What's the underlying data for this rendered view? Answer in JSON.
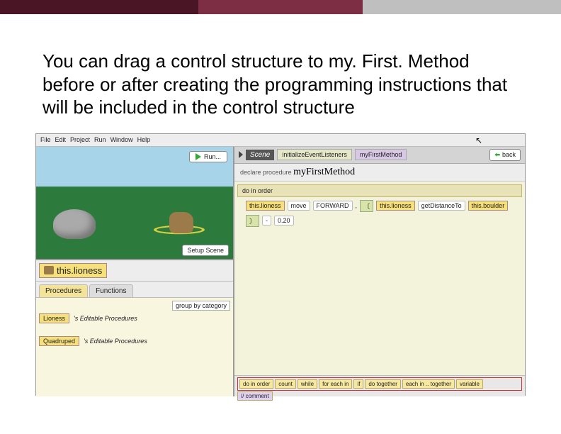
{
  "heading": "You can drag a control structure to my. First. Method before or after creating the programming instructions that will be included in the control structure",
  "menubar": {
    "items": [
      "File",
      "Edit",
      "Project",
      "Run",
      "Window",
      "Help"
    ]
  },
  "scene": {
    "run_label": "Run...",
    "setup_label": "Setup Scene"
  },
  "selected_object": "this.lioness",
  "tabs": {
    "procedures": "Procedures",
    "functions": "Functions"
  },
  "proc_panel": {
    "group_by": "group by category",
    "row1_chip": "Lioness",
    "row1_text": "'s Editable Procedures",
    "row2_chip": "Quadruped",
    "row2_text": "'s Editable Procedures"
  },
  "right": {
    "scene_label": "Scene",
    "tab1": "initializeEventListeners",
    "tab2": "myFirstMethod",
    "back": "back",
    "declare": "declare procedure",
    "method_name": "myFirstMethod",
    "do_in_order": "do in order"
  },
  "codeline": {
    "subject": "this.lioness",
    "verb": "move",
    "dir": "FORWARD",
    "comma": ",",
    "obj1": "this.lioness",
    "fn": "getDistanceTo",
    "obj2": "this.boulder",
    "minus": "-",
    "val": "0.20"
  },
  "controls": {
    "items": [
      "do in order",
      "count",
      "while",
      "for each in",
      "if",
      "do together",
      "each in .. together",
      "variable"
    ],
    "comment": "// comment"
  }
}
